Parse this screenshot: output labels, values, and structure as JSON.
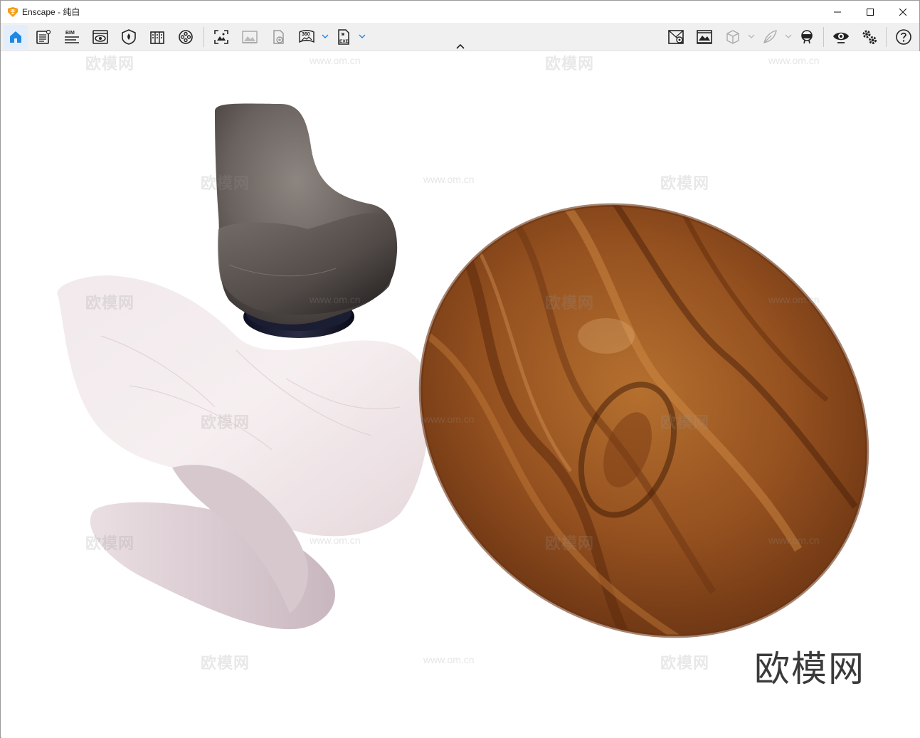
{
  "window": {
    "title": "Enscape - 纯白",
    "icons": {
      "app": "enscape-logo-icon",
      "minimize": "minimize-icon",
      "maximize": "maximize-icon",
      "close": "close-icon"
    }
  },
  "toolbar": {
    "left": [
      {
        "name": "home-icon"
      },
      {
        "name": "project-info-icon"
      },
      {
        "name": "bim-icon",
        "label": "BIM"
      },
      {
        "name": "visual-settings-icon"
      },
      {
        "name": "materials-icon"
      },
      {
        "name": "asset-library-icon"
      },
      {
        "name": "video-editor-icon"
      },
      {
        "name": "screenshot-icon"
      },
      {
        "name": "batch-render-icon"
      },
      {
        "name": "upload-icon"
      },
      {
        "name": "panorama-360-icon",
        "label": "360"
      },
      {
        "name": "export-exe-icon",
        "label": "EXE"
      }
    ],
    "right": [
      {
        "name": "views-icon"
      },
      {
        "name": "gallery-icon"
      },
      {
        "name": "cube-view-icon"
      },
      {
        "name": "sketch-mode-icon"
      },
      {
        "name": "vr-headset-icon"
      },
      {
        "name": "live-update-eye-icon"
      },
      {
        "name": "general-settings-icon"
      },
      {
        "name": "help-icon"
      }
    ],
    "collapse_icon": "chevron-up-icon"
  },
  "viewport": {
    "watermark_text": "欧模网",
    "watermark_url": "www.om.cn",
    "brand_mark": "欧模网",
    "objects": [
      {
        "name": "gray-leather-lounge-chair"
      },
      {
        "name": "white-wood-sculpted-chair"
      },
      {
        "name": "walnut-oval-tabletop"
      }
    ]
  },
  "colors": {
    "toolbar_bg": "#f0f0f0",
    "accent": "#1e88e5",
    "logo_orange": "#f39c12"
  }
}
